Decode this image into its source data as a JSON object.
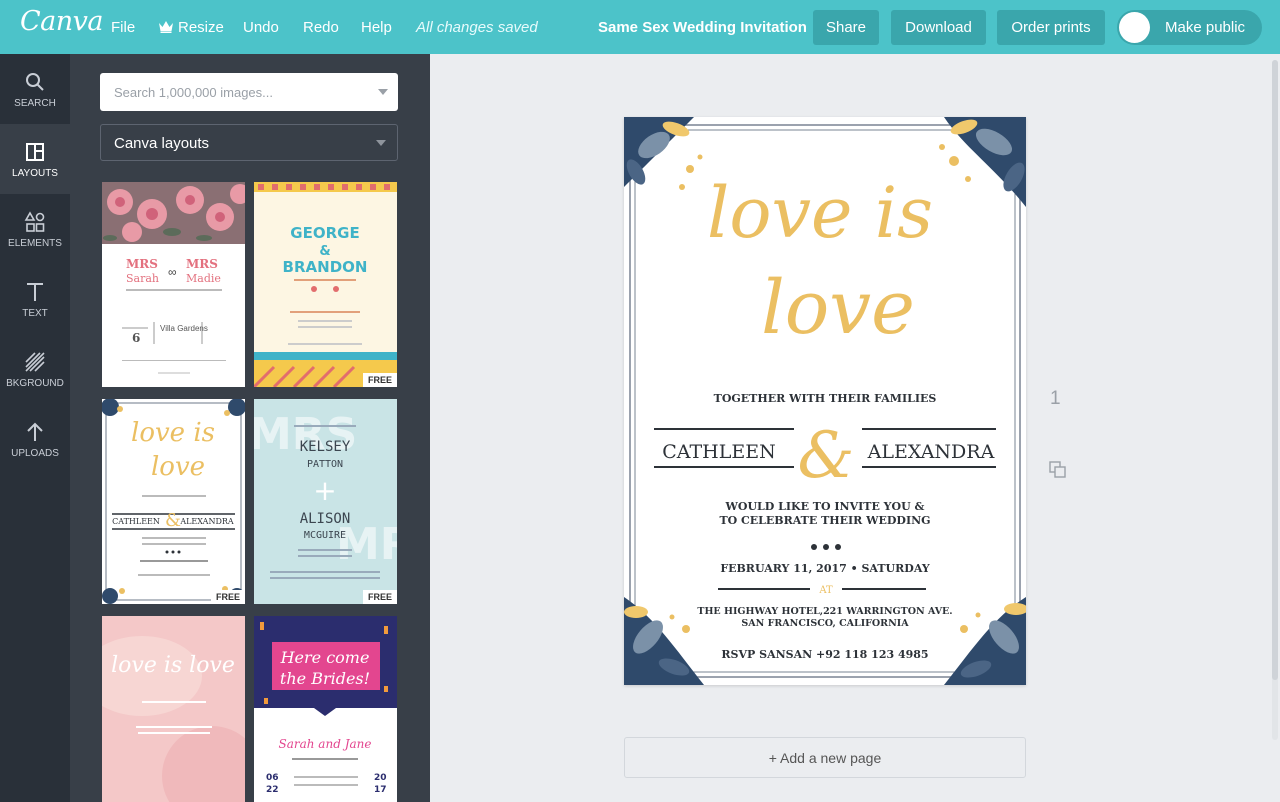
{
  "topbar": {
    "logo": "Canva",
    "menu": {
      "file": "File",
      "resize": "Resize",
      "undo": "Undo",
      "redo": "Redo",
      "help": "Help"
    },
    "save_status": "All changes saved",
    "document_title": "Same Sex Wedding Invitation",
    "share_label": "Share",
    "download_label": "Download",
    "order_prints_label": "Order prints",
    "make_public_label": "Make public"
  },
  "sidebar": {
    "items": [
      {
        "label": "SEARCH",
        "icon": "search-icon"
      },
      {
        "label": "LAYOUTS",
        "icon": "layouts-icon",
        "active": true
      },
      {
        "label": "ELEMENTS",
        "icon": "elements-icon"
      },
      {
        "label": "TEXT",
        "icon": "text-icon"
      },
      {
        "label": "BKGROUND",
        "icon": "background-icon"
      },
      {
        "label": "UPLOADS",
        "icon": "upload-icon"
      }
    ]
  },
  "panel": {
    "search_placeholder": "Search 1,000,000 images...",
    "category_selected": "Canva layouts",
    "free_badge": "FREE",
    "thumbnails": [
      {
        "names": [
          "MRS",
          "Sarah",
          "MRS",
          "Madie"
        ],
        "venue": "Villa Gardens",
        "day": "6",
        "free": false
      },
      {
        "names": [
          "GEORGE",
          "&",
          "BRANDON"
        ],
        "free": true
      },
      {
        "names": [
          "love is",
          "love",
          "CATHLEEN",
          "ALEXANDRA"
        ],
        "free": true
      },
      {
        "names": [
          "KELSEY",
          "PATTON",
          "+",
          "ALISON",
          "MCGUIRE"
        ],
        "bg_word": "MRS",
        "free": true
      },
      {
        "names": [
          "love is love"
        ],
        "free": false
      },
      {
        "names": [
          "Here come",
          "the Brides!",
          "Sarah and Jane",
          "06",
          "22",
          "20",
          "17"
        ],
        "free": false
      }
    ]
  },
  "canvas": {
    "page_number": "1",
    "add_page_label": "+ Add a new page",
    "invitation": {
      "headline_1": "love is",
      "headline_2": "love",
      "together": "TOGETHER WITH THEIR FAMILIES",
      "name_left": "CATHLEEN",
      "ampersand": "&",
      "name_right": "ALEXANDRA",
      "invite_line_1": "WOULD LIKE TO INVITE YOU &",
      "invite_line_2": "TO CELEBRATE THEIR WEDDING",
      "date": "FEBRUARY 11, 2017 • SATURDAY",
      "at": "AT",
      "venue_line_1": "THE HIGHWAY HOTEL,221 WARRINGTON AVE.",
      "venue_line_2": "SAN FRANCISCO, CALIFORNIA",
      "rsvp": "RSVP SANSAN +92 118 123 4985"
    }
  },
  "colors": {
    "topbar": "#4cc3c9",
    "topbar_button": "#3aa6ac",
    "rail": "#293039",
    "panel": "#383f48",
    "gold": "#ebbf62",
    "navy_leaf": "#2f4a6b"
  }
}
